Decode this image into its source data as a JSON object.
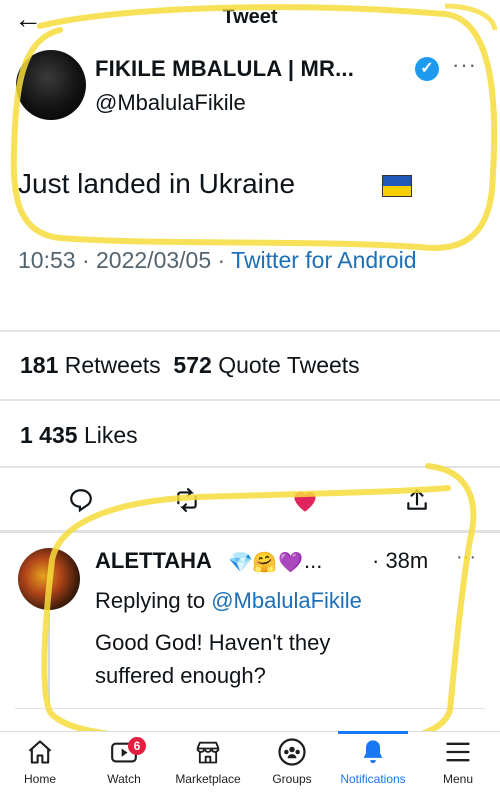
{
  "header": {
    "back_icon": "arrow-left-icon",
    "title": "Tweet"
  },
  "tweet": {
    "author_name": "FIKILE MBALULA | MR...",
    "verified_icon": "verified-badge-icon",
    "more_icon": "more-dots-icon",
    "more_label": "···",
    "handle": "@MbalulaFikile",
    "text": "Just landed in Ukraine",
    "flag_icon": "ukraine-flag-icon",
    "time": "10:53",
    "date": "2022/03/05",
    "client": "Twitter for Android",
    "retweets_count": "181",
    "retweets_label": "Retweets",
    "quotes_count": "572",
    "quotes_label": "Quote Tweets",
    "likes_count": "1 435",
    "likes_label": "Likes",
    "actions": [
      {
        "icon": "reply-icon"
      },
      {
        "icon": "retweet-icon"
      },
      {
        "icon": "heart-liked-icon",
        "color": "#e0245e"
      },
      {
        "icon": "share-icon"
      }
    ]
  },
  "reply": {
    "author_name": "ALETTAHA",
    "emojis": [
      "💎",
      "🤗",
      "💜"
    ],
    "ellipsis": "...",
    "time": "· 38m",
    "more_label": "···",
    "replying_prefix": "Replying to",
    "replying_handle": "@MbalulaFikile",
    "text": "Good God! Haven't they suffered enough?"
  },
  "bottom_nav": {
    "items": [
      {
        "label": "Home",
        "icon": "home-icon"
      },
      {
        "label": "Watch",
        "icon": "video-icon",
        "badge": "6"
      },
      {
        "label": "Marketplace",
        "icon": "store-icon"
      },
      {
        "label": "Groups",
        "icon": "groups-icon"
      },
      {
        "label": "Notifications",
        "icon": "bell-icon",
        "active": true
      },
      {
        "label": "Menu",
        "icon": "hamburger-menu-icon"
      }
    ],
    "active_color": "#1877f2"
  },
  "annotation": {
    "color": "#f6dc3c"
  }
}
